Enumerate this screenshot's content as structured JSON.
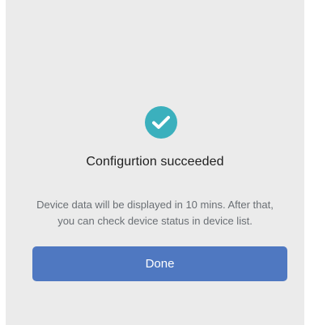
{
  "success": {
    "icon": "checkmark-icon",
    "accent_color": "#3bb0bd",
    "title": "Configurtion succeeded",
    "message_line1": "Device data will be displayed in 10 mins. After that,",
    "message_line2": "you can check device status  in device list."
  },
  "actions": {
    "done_label": "Done",
    "button_color": "#4f78c1"
  }
}
